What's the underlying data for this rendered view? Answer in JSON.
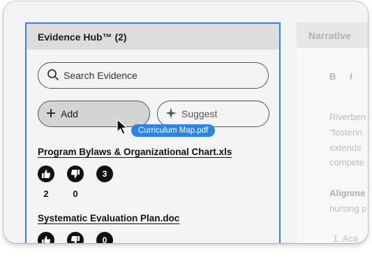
{
  "evidence_panel": {
    "title": "Evidence Hub™ (2)",
    "search_placeholder": "Search Evidence",
    "add_label": "Add",
    "suggest_label": "Suggest",
    "drag_tooltip": "Curriculum Map.pdf",
    "items": [
      {
        "title": "Program Bylaws & Organizational Chart.xls",
        "thumbs_up": "2",
        "thumbs_down": "0",
        "comments": "3"
      },
      {
        "title": "Systematic Evaluation Plan.doc",
        "thumbs_up": "",
        "thumbs_down": "",
        "comments": "0"
      }
    ]
  },
  "narrative_panel": {
    "title": "Narrative",
    "bold_label": "B",
    "italic_label": "I",
    "lines": [
      "Riverben",
      "\"fosterin",
      "extends",
      "compete"
    ],
    "alignment_heading": "Alignme",
    "alignment_line": "nursing p",
    "list_item": "1. Aca"
  }
}
